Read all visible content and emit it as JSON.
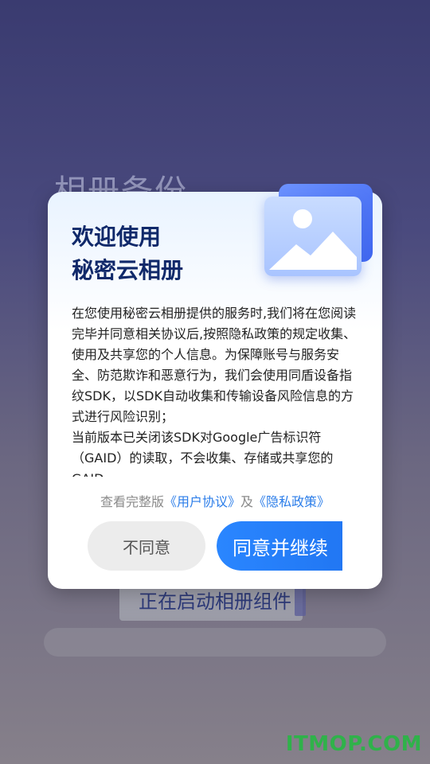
{
  "background": {
    "title": "相册备份",
    "status": "正在启动相册组件"
  },
  "dialog": {
    "title_line1": "欢迎使用",
    "title_line2": "秘密云相册",
    "illustration_icon": "image-icon",
    "body": "在您使用秘密云相册提供的服务时,我们将在您阅读完毕并同意相关协议后,按照隐私政策的规定收集、使用及共享您的个人信息。为保障账号与服务安全、防范欺诈和恶意行为，我们会使用同盾设备指纹SDK，以SDK自动收集和传输设备风险信息的方式进行风险识别；",
    "body_2": "当前版本已关闭该SDK对Google广告标识符（GAID）的读取，不会收集、存储或共享您的GAID。",
    "terms_prefix": "查看完整版",
    "user_agreement": "《用户协议》",
    "terms_and": "及",
    "privacy_policy": "《隐私政策》",
    "decline_label": "不同意",
    "agree_label": "同意并继续"
  },
  "watermark": "ITMOP.COM",
  "colors": {
    "accent": "#1f73f0",
    "link": "#2b7de9",
    "title": "#10296a",
    "watermark": "#2fb24a"
  }
}
